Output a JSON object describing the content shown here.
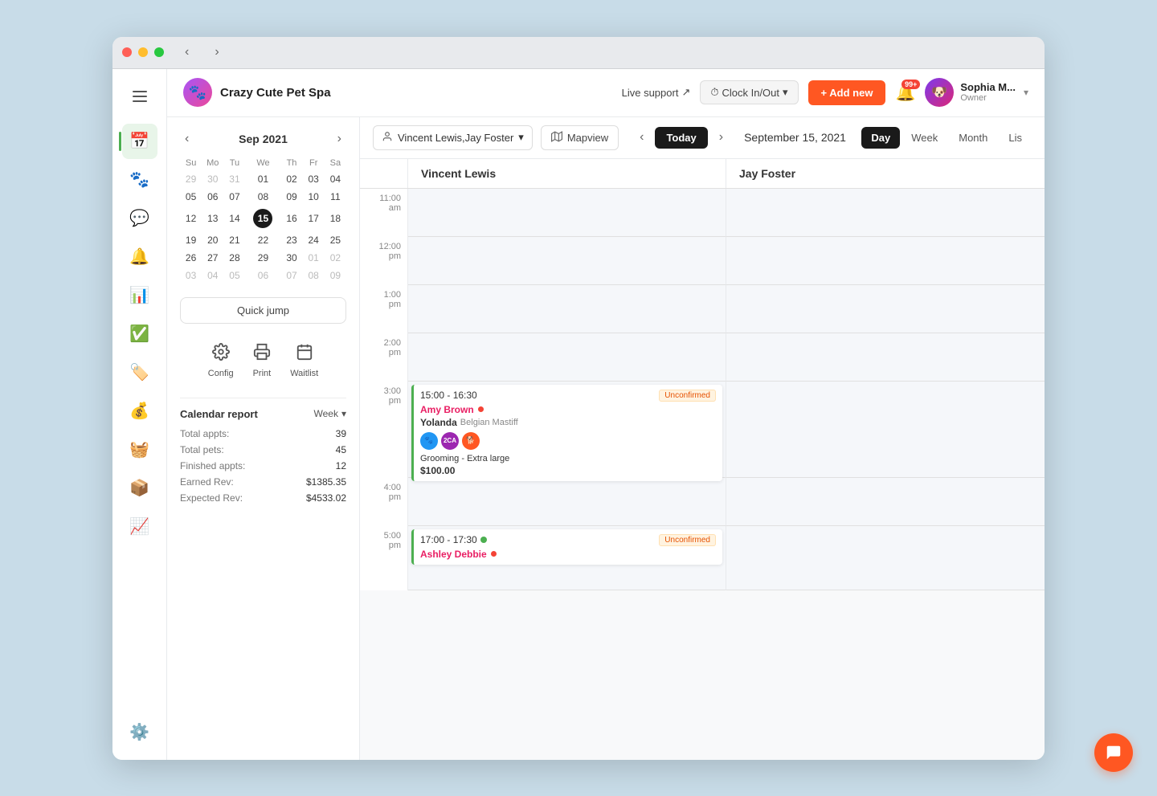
{
  "window": {
    "title": "Crazy Cute Pet Spa"
  },
  "topbar": {
    "brand_name": "Crazy Cute Pet Spa",
    "live_support": "Live support",
    "clock_in_out": "Clock In/Out",
    "add_new": "+ Add new",
    "notification_count": "99+",
    "user_name": "Sophia M...",
    "user_role": "Owner"
  },
  "sidebar": {
    "hamburger": "☰",
    "items": [
      {
        "icon": "📅",
        "label": "Calendar",
        "active": true
      },
      {
        "icon": "🐾",
        "label": "Pets",
        "active": false
      },
      {
        "icon": "💬",
        "label": "Messages",
        "active": false
      },
      {
        "icon": "🔔",
        "label": "Reminders",
        "active": false
      },
      {
        "icon": "📊",
        "label": "Reports",
        "active": false
      },
      {
        "icon": "✅",
        "label": "Tasks",
        "active": false
      },
      {
        "icon": "🏷️",
        "label": "Tags",
        "active": false
      },
      {
        "icon": "💰",
        "label": "Billing",
        "active": false
      },
      {
        "icon": "🧺",
        "label": "Laundry",
        "active": false
      },
      {
        "icon": "📦",
        "label": "Inventory",
        "active": false
      },
      {
        "icon": "📈",
        "label": "Analytics",
        "active": false
      },
      {
        "icon": "⚙️",
        "label": "Settings",
        "active": false
      }
    ]
  },
  "mini_calendar": {
    "month_year": "Sep 2021",
    "weekdays": [
      "Su",
      "Mo",
      "Tu",
      "We",
      "Th",
      "Fr",
      "Sa"
    ],
    "weeks": [
      [
        "29",
        "30",
        "31",
        "01",
        "02",
        "03",
        "04"
      ],
      [
        "05",
        "06",
        "07",
        "08",
        "09",
        "10",
        "11"
      ],
      [
        "12",
        "13",
        "14",
        "15",
        "16",
        "17",
        "18"
      ],
      [
        "19",
        "20",
        "21",
        "22",
        "23",
        "24",
        "25"
      ],
      [
        "26",
        "27",
        "28",
        "29",
        "30",
        "01",
        "02"
      ],
      [
        "03",
        "04",
        "05",
        "06",
        "07",
        "08",
        "09"
      ]
    ],
    "today": "15",
    "other_month_start": [
      "29",
      "30",
      "31"
    ],
    "other_month_end": [
      "01",
      "02",
      "03",
      "04",
      "05",
      "06",
      "07",
      "08",
      "09"
    ]
  },
  "quick_jump": "Quick jump",
  "action_buttons": [
    {
      "icon": "⚙️",
      "label": "Config"
    },
    {
      "icon": "🖨️",
      "label": "Print"
    },
    {
      "icon": "📋",
      "label": "Waitlist"
    }
  ],
  "calendar_report": {
    "title": "Calendar report",
    "period": "Week",
    "rows": [
      {
        "label": "Total appts:",
        "value": "39"
      },
      {
        "label": "Total pets:",
        "value": "45"
      },
      {
        "label": "Finished appts:",
        "value": "12"
      },
      {
        "label": "Earned Rev:",
        "value": "$1385.35"
      },
      {
        "label": "Expected Rev:",
        "value": "$4533.02"
      }
    ]
  },
  "calendar_view": {
    "staff_filter": "Vincent Lewis,Jay Foster",
    "mapview_label": "Mapview",
    "date_display": "September 15, 2021",
    "today_btn": "Today",
    "view_tabs": [
      "Day",
      "Week",
      "Month",
      "Lis"
    ],
    "active_tab": "Day",
    "staff_columns": [
      {
        "name": "Vincent Lewis"
      },
      {
        "name": "Jay Foster"
      }
    ]
  },
  "time_slots": [
    {
      "time": "11:00\nam",
      "half_label": ""
    },
    {
      "time": "12:00\npm",
      "half_label": ""
    },
    {
      "time": "1:00\npm",
      "half_label": ""
    },
    {
      "time": "2:00\npm",
      "half_label": ""
    },
    {
      "time": "3:00\npm",
      "half_label": ""
    },
    {
      "time": "4:00\npm",
      "half_label": ""
    },
    {
      "time": "5:00\npm",
      "half_label": ""
    }
  ],
  "appointments": [
    {
      "id": "appt1",
      "staff": "vincent",
      "time_range": "15:00 - 16:30",
      "status": "Unconfirmed",
      "customer": "Amy Brown",
      "pet_name": "Yolanda",
      "pet_breed": "Belgian Mastiff",
      "service": "Grooming - Extra large",
      "price": "$100.00",
      "row_start": 5,
      "info_dot": true
    },
    {
      "id": "appt2",
      "staff": "vincent",
      "time_range": "17:00 - 17:30",
      "status": "Unconfirmed",
      "customer": "Ashley Debbie",
      "pet_name": "",
      "pet_breed": "",
      "service": "",
      "price": "",
      "row_start": 7,
      "has_green_check": true,
      "info_dot": true
    }
  ],
  "chat_fab_icon": "💬"
}
